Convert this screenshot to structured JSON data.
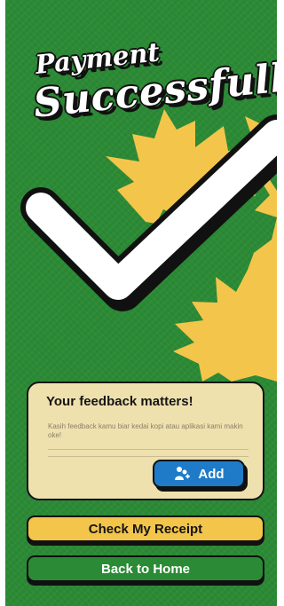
{
  "header": {
    "title_line1": "Payment",
    "title_line2": "Successfull"
  },
  "feedback": {
    "title": "Your feedback matters!",
    "placeholder": "Kasih feedback kamu biar kedai kopi atau aplikasi kami makin oke!",
    "add_label": "Add"
  },
  "actions": {
    "receipt_label": "Check My Receipt",
    "home_label": "Back to Home"
  },
  "icons": {
    "success": "checkmark-icon",
    "burst": "starburst-icon",
    "add": "feedback-add-icon"
  },
  "colors": {
    "background": "#2b8a35",
    "accent": "#f3c54b",
    "card": "#efe1ad",
    "button_blue": "#1f7bc8"
  }
}
